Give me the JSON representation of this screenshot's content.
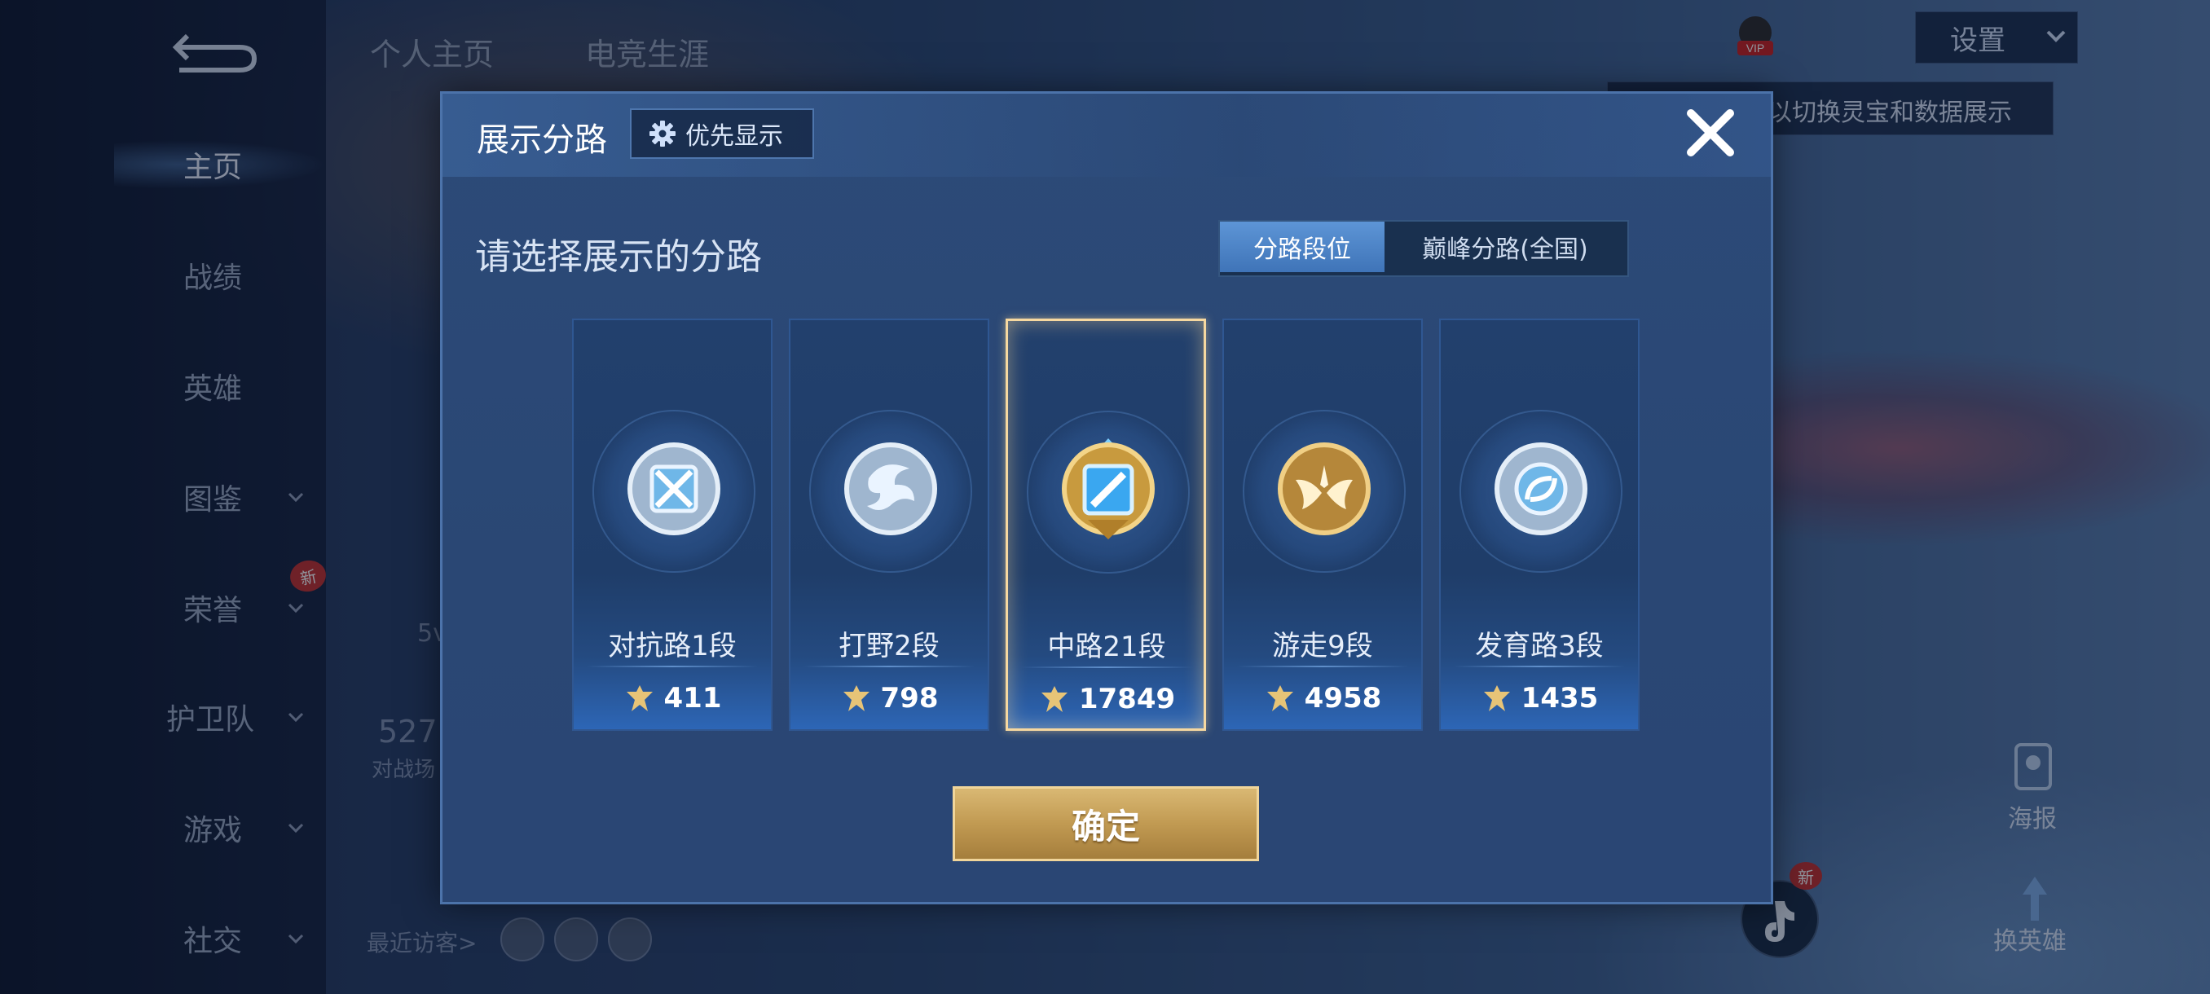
{
  "background": {
    "sidenav": {
      "items": [
        {
          "label": "主页",
          "active": true,
          "has_chevron": false
        },
        {
          "label": "战绩",
          "active": false,
          "has_chevron": false
        },
        {
          "label": "英雄",
          "active": false,
          "has_chevron": false
        },
        {
          "label": "图鉴",
          "active": false,
          "has_chevron": true
        },
        {
          "label": "荣誉",
          "active": false,
          "has_chevron": true
        },
        {
          "label": "护卫队",
          "active": false,
          "has_chevron": true
        },
        {
          "label": "游戏",
          "active": false,
          "has_chevron": true
        },
        {
          "label": "社交",
          "active": false,
          "has_chevron": true
        }
      ],
      "new_badge": "新"
    },
    "top_tabs": [
      "个人主页",
      "电竞生涯"
    ],
    "stat_5v": "5v",
    "stat_number": "527",
    "stat_label": "对战场",
    "recent_visitors_label": "最近访客>",
    "settings_label": "设置",
    "tip_text": "以切换灵宝和数据展示",
    "vip_label": "VIP",
    "poster_label": "海报",
    "change_hero_label": "换英雄",
    "new_badge_right": "新"
  },
  "modal": {
    "title": "展示分路",
    "priority_label": "优先显示",
    "subtitle": "请选择展示的分路",
    "tabs": [
      "分路段位",
      "巅峰分路(全国)"
    ],
    "active_tab": 0,
    "lanes": [
      {
        "name": "对抗路1段",
        "score": "411",
        "emblem": "clash-lane-emblem",
        "tier": "silver"
      },
      {
        "name": "打野2段",
        "score": "798",
        "emblem": "jungle-emblem",
        "tier": "silver"
      },
      {
        "name": "中路21段",
        "score": "17849",
        "emblem": "mid-lane-emblem",
        "tier": "gold",
        "selected": true
      },
      {
        "name": "游走9段",
        "score": "4958",
        "emblem": "roam-emblem",
        "tier": "gold"
      },
      {
        "name": "发育路3段",
        "score": "1435",
        "emblem": "farm-lane-emblem",
        "tier": "silver"
      }
    ],
    "confirm_label": "确定"
  },
  "colors": {
    "accent_gold": "#c8a25c",
    "selected_border": "#f6d8a0",
    "tab_active": "#4f86c9"
  }
}
